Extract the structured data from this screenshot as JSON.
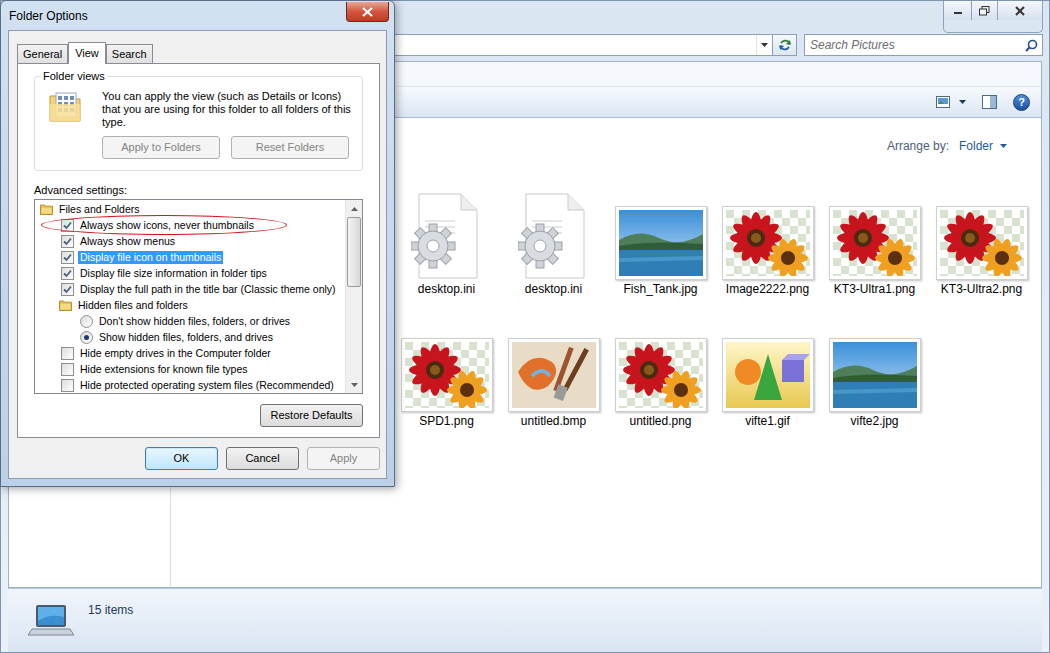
{
  "explorer": {
    "search": {
      "placeholder": "Search Pictures"
    },
    "toolbar": {
      "help": "?"
    },
    "arrange": {
      "label": "Arrange by:",
      "value": "Folder"
    },
    "files": [
      {
        "name": "desktop.ini",
        "kind": "settings"
      },
      {
        "name": "desktop.ini",
        "kind": "settings"
      },
      {
        "name": "Fish_Tank.jpg",
        "kind": "landscape"
      },
      {
        "name": "Image2222.png",
        "kind": "flowers"
      },
      {
        "name": "KT3-Ultra1.png",
        "kind": "flowers"
      },
      {
        "name": "KT3-Ultra2.png",
        "kind": "flowers"
      },
      {
        "name": "SPD1.png",
        "kind": "flowers"
      },
      {
        "name": "untitled.bmp",
        "kind": "paint"
      },
      {
        "name": "untitled.png",
        "kind": "flowers"
      },
      {
        "name": "vifte1.gif",
        "kind": "shapes"
      },
      {
        "name": "vifte2.jpg",
        "kind": "landscape"
      }
    ],
    "status_bar": {
      "count": "15 items"
    }
  },
  "dialog": {
    "title": "Folder Options",
    "tabs": [
      {
        "label": "General",
        "selected": false
      },
      {
        "label": "View",
        "selected": true
      },
      {
        "label": "Search",
        "selected": false
      }
    ],
    "folder_views": {
      "legend": "Folder views",
      "description": "You can apply the view (such as Details or Icons) that you are using for this folder to all folders of this type.",
      "buttons": [
        {
          "label": "Apply to Folders",
          "disabled": true
        },
        {
          "label": "Reset Folders",
          "disabled": true
        }
      ]
    },
    "advanced": {
      "label": "Advanced settings:",
      "scrollbar": {
        "level": 0.44
      },
      "items": [
        {
          "kind": "folder",
          "label": "Files and Folders",
          "depth": 0
        },
        {
          "kind": "checkbox",
          "label": "Always show icons, never thumbnails",
          "depth": 1,
          "checked": true,
          "selected": false,
          "annotated": true
        },
        {
          "kind": "checkbox",
          "label": "Always show menus",
          "depth": 1,
          "checked": true,
          "selected": false,
          "annotated": false
        },
        {
          "kind": "checkbox",
          "label": "Display file icon on thumbnails",
          "depth": 1,
          "checked": true,
          "selected": true,
          "annotated": false
        },
        {
          "kind": "checkbox",
          "label": "Display file size information in folder tips",
          "depth": 1,
          "checked": true,
          "selected": false,
          "annotated": false
        },
        {
          "kind": "checkbox",
          "label": "Display the full path in the title bar (Classic theme only)",
          "depth": 1,
          "checked": true,
          "selected": false,
          "annotated": false
        },
        {
          "kind": "folder",
          "label": "Hidden files and folders",
          "depth": 1
        },
        {
          "kind": "radio",
          "label": "Don't show hidden files, folders, or drives",
          "depth": 2,
          "checked": false,
          "selected": false,
          "annotated": false
        },
        {
          "kind": "radio",
          "label": "Show hidden files, folders, and drives",
          "depth": 2,
          "checked": true,
          "selected": false,
          "annotated": false
        },
        {
          "kind": "checkbox",
          "label": "Hide empty drives in the Computer folder",
          "depth": 1,
          "checked": false,
          "selected": false,
          "annotated": false
        },
        {
          "kind": "checkbox",
          "label": "Hide extensions for known file types",
          "depth": 1,
          "checked": false,
          "selected": false,
          "annotated": false
        },
        {
          "kind": "checkbox",
          "label": "Hide protected operating system files (Recommended)",
          "depth": 1,
          "checked": false,
          "selected": false,
          "annotated": false
        }
      ]
    },
    "restore_button": {
      "label": "Restore Defaults",
      "disabled": false
    },
    "buttons": [
      {
        "label": "OK",
        "default": true,
        "disabled": false
      },
      {
        "label": "Cancel",
        "default": false,
        "disabled": false
      },
      {
        "label": "Apply",
        "default": false,
        "disabled": true
      }
    ]
  }
}
